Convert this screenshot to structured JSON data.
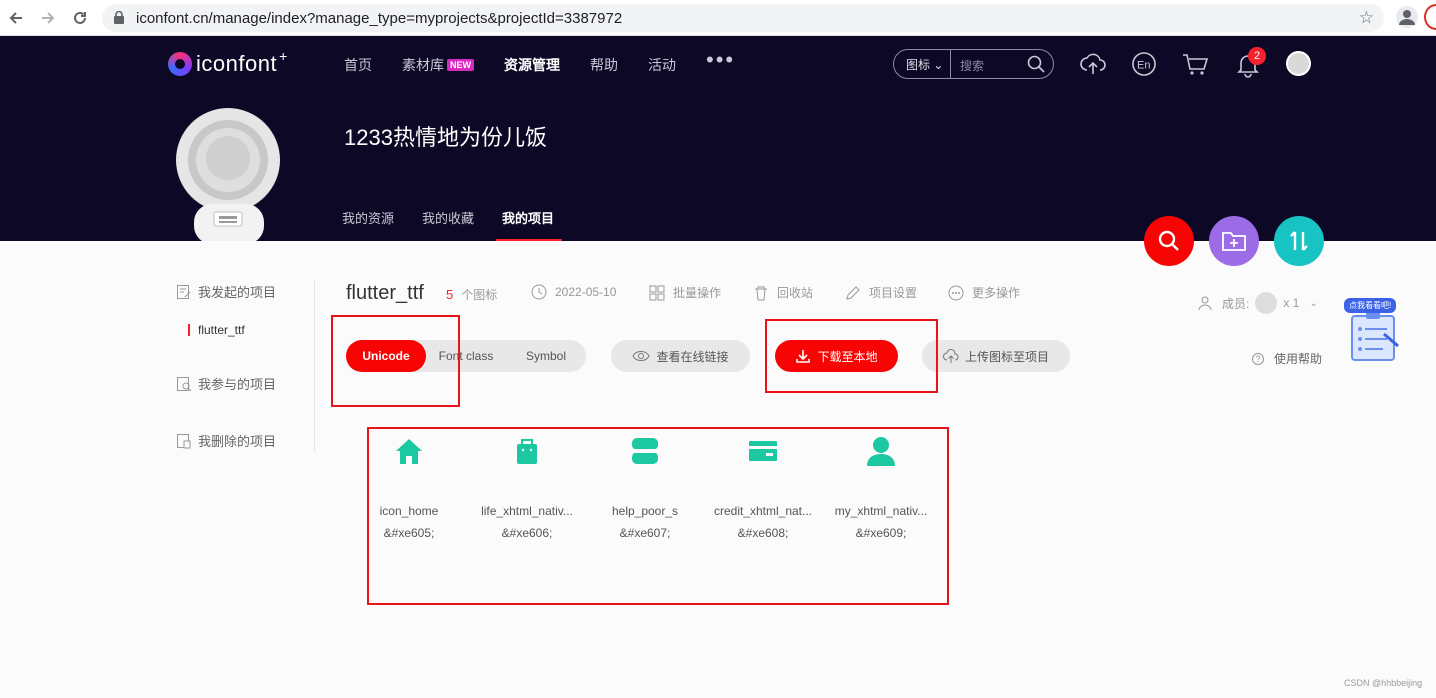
{
  "browser": {
    "url": "iconfont.cn/manage/index?manage_type=myprojects&projectId=3387972"
  },
  "site": {
    "logo_text": "iconfont",
    "logo_plus": "+",
    "nav": [
      "首页",
      "素材库",
      "资源管理",
      "帮助",
      "活动"
    ],
    "nav_badge": "NEW",
    "more": "•••",
    "search_type": "图标",
    "search_placeholder": "搜索",
    "notifications": "2"
  },
  "user": {
    "name": "1233热情地为份儿饭",
    "tabs": [
      "我的资源",
      "我的收藏",
      "我的项目"
    ]
  },
  "sidebar": {
    "started": "我发起的项目",
    "project": "flutter_ttf",
    "joined": "我参与的项目",
    "deleted": "我删除的项目"
  },
  "project": {
    "name": "flutter_ttf",
    "count": "5",
    "count_label": "个图标",
    "date": "2022-05-10",
    "batch": "批量操作",
    "recycle": "回收站",
    "settings": "项目设置",
    "more": "更多操作",
    "members_label": "成员:",
    "members_count": "x 1",
    "help": "使用帮助"
  },
  "toolbar": {
    "tabs": [
      "Unicode",
      "Font class",
      "Symbol"
    ],
    "view_link": "查看在线链接",
    "download": "下载至本地",
    "upload": "上传图标至项目"
  },
  "icons": [
    {
      "name": "icon_home",
      "code": "&#xe605;",
      "icon": "home-icon"
    },
    {
      "name": "life_xhtml_nativ...",
      "code": "&#xe606;",
      "icon": "bag-icon"
    },
    {
      "name": "help_poor_s",
      "code": "&#xe607;",
      "icon": "store-icon"
    },
    {
      "name": "credit_xhtml_nat...",
      "code": "&#xe608;",
      "icon": "card-icon"
    },
    {
      "name": "my_xhtml_nativ...",
      "code": "&#xe609;",
      "icon": "user-icon"
    }
  ],
  "helper_label": "点我看看吧!",
  "watermark": "CSDN @hhbbeijing",
  "colors": {
    "header_bg": "#0c0825",
    "accent_red": "#f70505",
    "icon_teal": "#1bc8a2",
    "fab_purple": "#9b6ce6",
    "fab_teal": "#17c3c3"
  }
}
